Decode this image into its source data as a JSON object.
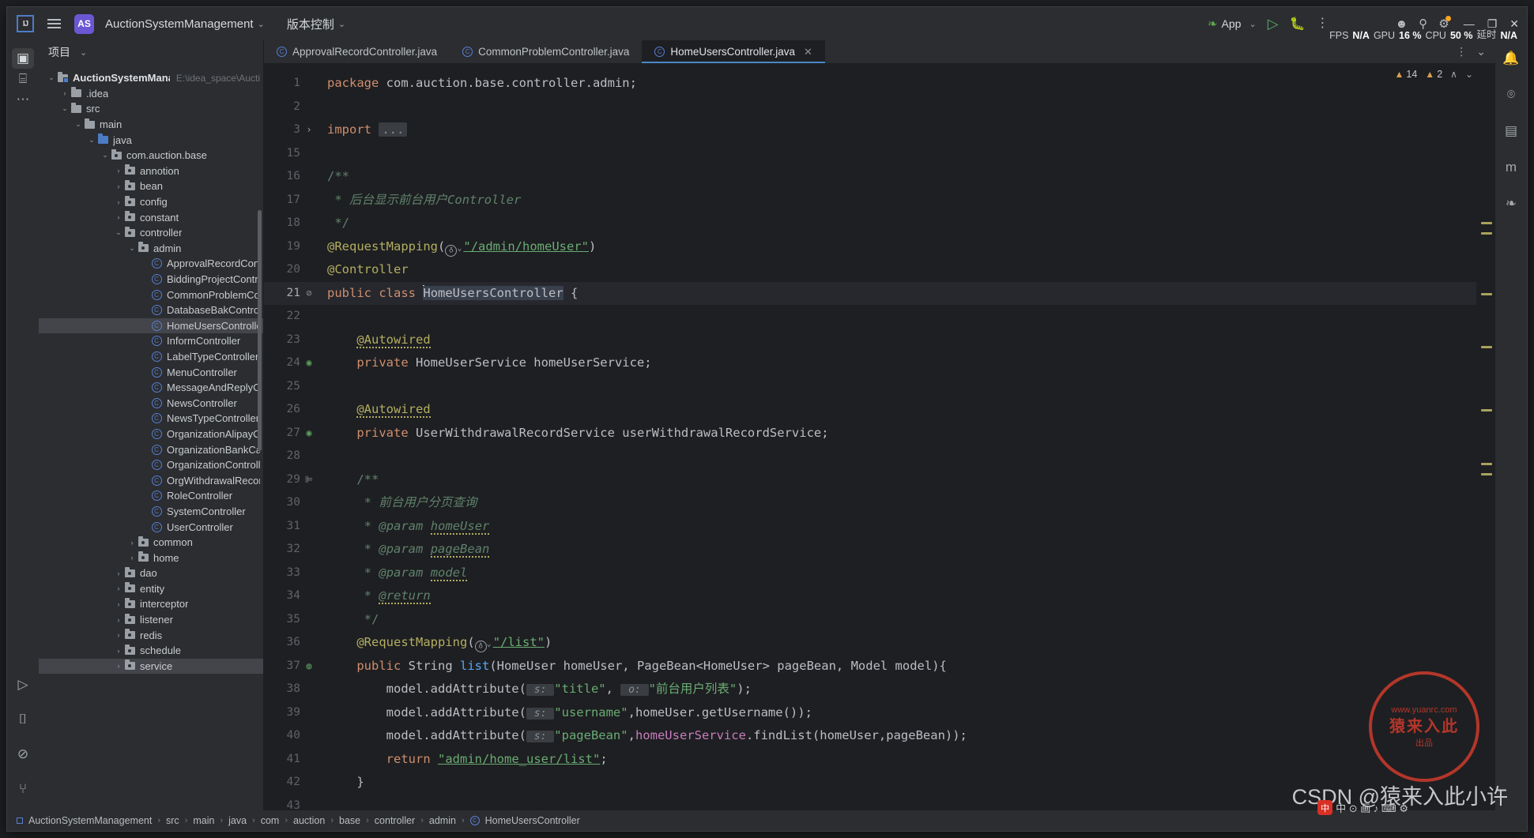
{
  "titlebar": {
    "menu_icon": "hamburger-icon",
    "project_badge": "AS",
    "project_name": "AuctionSystemManagement",
    "vcs_label": "版本控制",
    "chevron": "⌄",
    "run_config": "App",
    "run_icon": "play-icon",
    "debug_icon": "bug-icon",
    "more_icon": "more-vertical-icon",
    "account_icon": "account-icon",
    "search_icon": "search-icon",
    "settings_icon": "gear-icon",
    "minimize": "—",
    "maximize": "❐",
    "close": "✕"
  },
  "perf": {
    "fps_label": "FPS",
    "fps_value": "N/A",
    "gpu_label": "GPU",
    "gpu_value": "16 %",
    "cpu_label": "CPU",
    "cpu_value": "50 %",
    "latency_label": "延时",
    "latency_value": "N/A"
  },
  "left_stripe": [
    {
      "name": "project-tool-icon",
      "glyph": "▣",
      "selected": true
    },
    {
      "name": "structure-tool-icon",
      "glyph": "⌸",
      "selected": false
    },
    {
      "name": "more-tool-icon",
      "glyph": "⋯",
      "selected": false
    }
  ],
  "left_stripe_bottom": [
    {
      "name": "run-tool-icon",
      "glyph": "▷"
    },
    {
      "name": "terminal-tool-icon",
      "glyph": "⌷"
    },
    {
      "name": "problems-tool-icon",
      "glyph": "⊘"
    },
    {
      "name": "git-tool-icon",
      "glyph": "⑂"
    }
  ],
  "right_stripe": [
    {
      "name": "notifications-icon",
      "glyph": "🔔"
    },
    {
      "name": "ai-assistant-icon",
      "glyph": "⌾"
    },
    {
      "name": "database-icon",
      "glyph": "▤"
    },
    {
      "name": "maven-icon",
      "glyph": "m"
    },
    {
      "name": "spring-icon",
      "glyph": "❧"
    }
  ],
  "project_panel": {
    "title": "项目",
    "chevron": "⌄",
    "tree": [
      {
        "depth": 0,
        "arrow": "⌄",
        "icon": "module-folder",
        "label": "AuctionSystemManagement",
        "bold": true,
        "path": "E:\\idea_space\\Aucti",
        "selected": false
      },
      {
        "depth": 1,
        "arrow": "›",
        "icon": "folder",
        "label": ".idea",
        "selected": false
      },
      {
        "depth": 1,
        "arrow": "⌄",
        "icon": "folder",
        "label": "src",
        "selected": false
      },
      {
        "depth": 2,
        "arrow": "⌄",
        "icon": "folder",
        "label": "main",
        "selected": false
      },
      {
        "depth": 3,
        "arrow": "⌄",
        "icon": "folder-blue",
        "label": "java",
        "selected": false
      },
      {
        "depth": 4,
        "arrow": "⌄",
        "icon": "package",
        "label": "com.auction.base",
        "selected": false
      },
      {
        "depth": 5,
        "arrow": "›",
        "icon": "package",
        "label": "annotion",
        "selected": false
      },
      {
        "depth": 5,
        "arrow": "›",
        "icon": "package",
        "label": "bean",
        "selected": false
      },
      {
        "depth": 5,
        "arrow": "›",
        "icon": "package",
        "label": "config",
        "selected": false
      },
      {
        "depth": 5,
        "arrow": "›",
        "icon": "package",
        "label": "constant",
        "selected": false
      },
      {
        "depth": 5,
        "arrow": "⌄",
        "icon": "package",
        "label": "controller",
        "selected": false
      },
      {
        "depth": 6,
        "arrow": "⌄",
        "icon": "package",
        "label": "admin",
        "selected": false
      },
      {
        "depth": 7,
        "arrow": "",
        "icon": "class",
        "label": "ApprovalRecordController",
        "selected": false
      },
      {
        "depth": 7,
        "arrow": "",
        "icon": "class",
        "label": "BiddingProjectController",
        "selected": false
      },
      {
        "depth": 7,
        "arrow": "",
        "icon": "class",
        "label": "CommonProblemController",
        "selected": false
      },
      {
        "depth": 7,
        "arrow": "",
        "icon": "class",
        "label": "DatabaseBakController",
        "selected": false
      },
      {
        "depth": 7,
        "arrow": "",
        "icon": "class",
        "label": "HomeUsersController",
        "selected": true
      },
      {
        "depth": 7,
        "arrow": "",
        "icon": "class",
        "label": "InformController",
        "selected": false
      },
      {
        "depth": 7,
        "arrow": "",
        "icon": "class",
        "label": "LabelTypeController",
        "selected": false
      },
      {
        "depth": 7,
        "arrow": "",
        "icon": "class",
        "label": "MenuController",
        "selected": false
      },
      {
        "depth": 7,
        "arrow": "",
        "icon": "class",
        "label": "MessageAndReplyController",
        "selected": false
      },
      {
        "depth": 7,
        "arrow": "",
        "icon": "class",
        "label": "NewsController",
        "selected": false
      },
      {
        "depth": 7,
        "arrow": "",
        "icon": "class",
        "label": "NewsTypeController",
        "selected": false
      },
      {
        "depth": 7,
        "arrow": "",
        "icon": "class",
        "label": "OrganizationAlipayController",
        "selected": false
      },
      {
        "depth": 7,
        "arrow": "",
        "icon": "class",
        "label": "OrganizationBankCardController",
        "selected": false
      },
      {
        "depth": 7,
        "arrow": "",
        "icon": "class",
        "label": "OrganizationController",
        "selected": false
      },
      {
        "depth": 7,
        "arrow": "",
        "icon": "class",
        "label": "OrgWithdrawalRecordController",
        "selected": false
      },
      {
        "depth": 7,
        "arrow": "",
        "icon": "class",
        "label": "RoleController",
        "selected": false
      },
      {
        "depth": 7,
        "arrow": "",
        "icon": "class",
        "label": "SystemController",
        "selected": false
      },
      {
        "depth": 7,
        "arrow": "",
        "icon": "class",
        "label": "UserController",
        "selected": false
      },
      {
        "depth": 6,
        "arrow": "›",
        "icon": "package",
        "label": "common",
        "selected": false
      },
      {
        "depth": 6,
        "arrow": "›",
        "icon": "package",
        "label": "home",
        "selected": false
      },
      {
        "depth": 5,
        "arrow": "›",
        "icon": "package",
        "label": "dao",
        "selected": false
      },
      {
        "depth": 5,
        "arrow": "›",
        "icon": "package",
        "label": "entity",
        "selected": false
      },
      {
        "depth": 5,
        "arrow": "›",
        "icon": "package",
        "label": "interceptor",
        "selected": false
      },
      {
        "depth": 5,
        "arrow": "›",
        "icon": "package",
        "label": "listener",
        "selected": false
      },
      {
        "depth": 5,
        "arrow": "›",
        "icon": "package",
        "label": "redis",
        "selected": false
      },
      {
        "depth": 5,
        "arrow": "›",
        "icon": "package",
        "label": "schedule",
        "selected": false
      },
      {
        "depth": 5,
        "arrow": "›",
        "icon": "package",
        "label": "service",
        "selected": true
      }
    ]
  },
  "tabs": [
    {
      "label": "ApprovalRecordController.java",
      "active": false,
      "closable": false
    },
    {
      "label": "CommonProblemController.java",
      "active": false,
      "closable": false
    },
    {
      "label": "HomeUsersController.java",
      "active": true,
      "closable": true
    }
  ],
  "tabbar_right": [
    {
      "name": "editor-options-icon",
      "glyph": "⋮"
    },
    {
      "name": "editor-collapse-icon",
      "glyph": "⌄"
    }
  ],
  "inspections": {
    "warning_icon": "warning-triangle-icon",
    "warning_count": "14",
    "weak_warning_count": "2",
    "up_arrow": "∧",
    "down_arrow": "⌄"
  },
  "editor": {
    "file": "HomeUsersController.java",
    "lines": [
      {
        "num": "1",
        "gi": "",
        "cur": false
      },
      {
        "num": "2",
        "gi": "",
        "cur": false
      },
      {
        "num": "3",
        "gi": "›",
        "cur": false
      },
      {
        "num": "15",
        "gi": "",
        "cur": false
      },
      {
        "num": "16",
        "gi": "",
        "cur": false
      },
      {
        "num": "17",
        "gi": "",
        "cur": false
      },
      {
        "num": "18",
        "gi": "",
        "cur": false
      },
      {
        "num": "19",
        "gi": "",
        "cur": false
      },
      {
        "num": "20",
        "gi": "",
        "cur": false
      },
      {
        "num": "21",
        "gi": "⊘",
        "cur": true
      },
      {
        "num": "22",
        "gi": "",
        "cur": false
      },
      {
        "num": "23",
        "gi": "",
        "cur": false
      },
      {
        "num": "24",
        "gi": "◉",
        "cur": false
      },
      {
        "num": "25",
        "gi": "",
        "cur": false
      },
      {
        "num": "26",
        "gi": "",
        "cur": false
      },
      {
        "num": "27",
        "gi": "◉",
        "cur": false
      },
      {
        "num": "28",
        "gi": "",
        "cur": false
      },
      {
        "num": "29",
        "gi": "⊫",
        "cur": false
      },
      {
        "num": "30",
        "gi": "",
        "cur": false
      },
      {
        "num": "31",
        "gi": "",
        "cur": false
      },
      {
        "num": "32",
        "gi": "",
        "cur": false
      },
      {
        "num": "33",
        "gi": "",
        "cur": false
      },
      {
        "num": "34",
        "gi": "",
        "cur": false
      },
      {
        "num": "35",
        "gi": "",
        "cur": false
      },
      {
        "num": "36",
        "gi": "",
        "cur": false
      },
      {
        "num": "37",
        "gi": "◍",
        "cur": false
      },
      {
        "num": "38",
        "gi": "",
        "cur": false
      },
      {
        "num": "39",
        "gi": "",
        "cur": false
      },
      {
        "num": "40",
        "gi": "",
        "cur": false
      },
      {
        "num": "41",
        "gi": "",
        "cur": false
      },
      {
        "num": "42",
        "gi": "",
        "cur": false
      },
      {
        "num": "43",
        "gi": "",
        "cur": false
      }
    ],
    "source_text": [
      "package com.auction.base.controller.admin;",
      "",
      "import ...",
      "",
      "/**",
      " * 后台显示前台用户Controller",
      " */",
      "@RequestMapping(\"/admin/homeUser\")",
      "@Controller",
      "public class HomeUsersController {",
      "",
      "    @Autowired",
      "    private HomeUserService homeUserService;",
      "",
      "    @Autowired",
      "    private UserWithdrawalRecordService userWithdrawalRecordService;",
      "",
      "    /**",
      "     * 前台用户分页查询",
      "     * @param homeUser",
      "     * @param pageBean",
      "     * @param model",
      "     * @return",
      "     */",
      "    @RequestMapping(\"/list\")",
      "    public String list(HomeUser homeUser, PageBean<HomeUser> pageBean, Model model){",
      "        model.addAttribute( s: \"title\", o: \"前台用户列表\");",
      "        model.addAttribute( s: \"username\",homeUser.getUsername());",
      "        model.addAttribute( s: \"pageBean\",homeUserService.findList(homeUser,pageBean));",
      "        return \"admin/home_user/list\";",
      "    }",
      ""
    ]
  },
  "statusbar": {
    "breadcrumb": [
      "AuctionSystemManagement",
      "src",
      "main",
      "java",
      "com",
      "auction",
      "base",
      "controller",
      "admin",
      "HomeUsersController"
    ],
    "separator": "›"
  },
  "watermark": {
    "stamp_top": "www.yuanrc.com",
    "stamp_main": "猿来入此",
    "stamp_bottom": "出品",
    "csdn_text": "CSDN @猿来入此小许",
    "ime_badge": "中",
    "ime_text": "中 ⊙ 画 ♪ ⌨ ⚙"
  }
}
